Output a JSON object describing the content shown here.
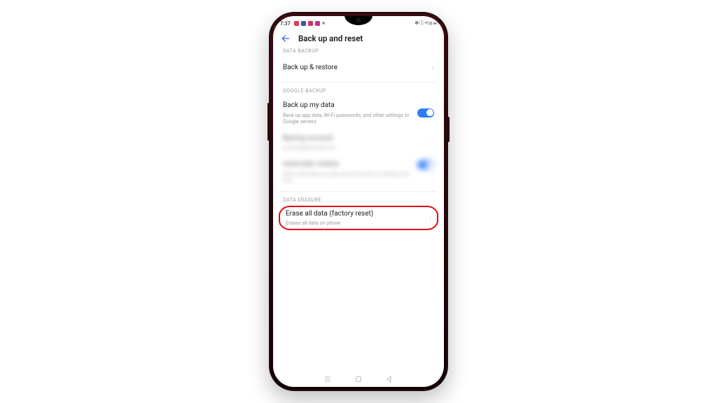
{
  "status": {
    "time": "7:37",
    "right_icons": "✻ ⓘ ⩤ ⦾ ⫘"
  },
  "header": {
    "title": "Back up and reset"
  },
  "sections": {
    "data_backup": {
      "label": "DATA BACKUP",
      "backup_restore": {
        "title": "Back up & restore"
      }
    },
    "google_backup": {
      "label": "GOOGLE BACKUP",
      "backup_my_data": {
        "title": "Back up my data",
        "sub": "Back up app data, Wi-Fi passwords, and other settings to Google servers",
        "enabled": true
      },
      "backup_account": {
        "title": "Backup account",
        "sub": "account@example.com"
      },
      "automatic_restore": {
        "title": "Automatic restore",
        "sub": "When reinstalling an app, restore backed up settings and data",
        "enabled": true
      }
    },
    "data_erasure": {
      "label": "DATA ERASURE",
      "erase_all": {
        "title": "Erase all data (factory reset)",
        "sub": "Erases all data on phone"
      }
    }
  },
  "annotation": {
    "highlight_color": "#e30613"
  }
}
